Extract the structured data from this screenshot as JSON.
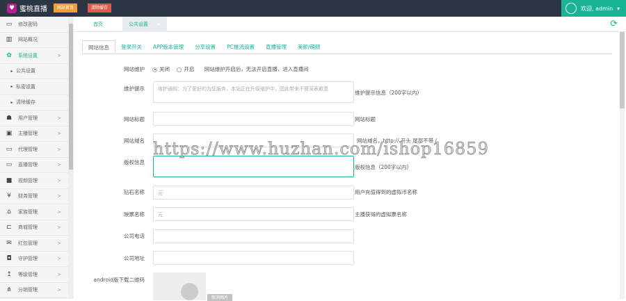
{
  "header": {
    "app_name": "蜜桃直播",
    "home_btn": "网站首页",
    "clear_cache_btn": "清除缓存",
    "user_greeting": "欢迎, admin",
    "colors": {
      "header": "#2b3544",
      "accent": "#1ab394",
      "home_btn": "#f0a030",
      "clear_btn": "#e4574e"
    }
  },
  "sidebar": {
    "items": [
      {
        "label": "修改密码",
        "icon": "monitor-icon"
      },
      {
        "label": "网站概况",
        "icon": "bar-chart-icon"
      },
      {
        "label": "系统设置",
        "icon": "gears-icon"
      },
      {
        "label": "公共设置",
        "icon": "caret-icon"
      },
      {
        "label": "私密设置",
        "icon": "caret-icon"
      },
      {
        "label": "清除缓存",
        "icon": "caret-icon"
      },
      {
        "label": "用户管理",
        "icon": "users-icon"
      },
      {
        "label": "主播管理",
        "icon": "id-badge-icon"
      },
      {
        "label": "代理管理",
        "icon": "monitor-icon"
      },
      {
        "label": "直播管理",
        "icon": "monitor-icon"
      },
      {
        "label": "视频管理",
        "icon": "video-icon"
      },
      {
        "label": "财务管理",
        "icon": "yen-icon"
      },
      {
        "label": "家族管理",
        "icon": "bank-icon"
      },
      {
        "label": "商城管理",
        "icon": "cart-icon"
      },
      {
        "label": "红包管理",
        "icon": "envelope-icon"
      },
      {
        "label": "守护管理",
        "icon": "shield-icon"
      },
      {
        "label": "等级管理",
        "icon": "level-up-icon"
      },
      {
        "label": "分销管理",
        "icon": "sitemap-icon"
      }
    ]
  },
  "tabs": [
    {
      "label": "首页"
    },
    {
      "label": "公共设置"
    }
  ],
  "subtabs": [
    "网站信息",
    "登录开关",
    "APP版本管理",
    "分享设置",
    "PC推流设置",
    "直播管理",
    "美颜/萌颜"
  ],
  "form": {
    "maintenance": {
      "label": "网站维护",
      "off": "关闭",
      "on": "开启",
      "selected": "关闭",
      "hint": "网站维护开启后，无法开启直播，进入直播间"
    },
    "maint_tip": {
      "label": "维护提示",
      "placeholder": "维护通知：为了更好的为您服务，本站正在升级维护中，因此带来不便深表歉意",
      "hint": "维护提示信息（200字以内）"
    },
    "site_title": {
      "label": "网站标题",
      "value": "",
      "hint": "网站标题"
    },
    "site_domain": {
      "label": "网站域名",
      "value": "",
      "hint": "网站域名，http:// 开头 尾部不带 /"
    },
    "copyright": {
      "label": "版权信息",
      "value": "",
      "hint": "版权信息（200字以内）"
    },
    "diamond_name": {
      "label": "钻石名称",
      "value": "元",
      "hint": "用户充值得到的虚拟币名称"
    },
    "ticket_name": {
      "label": "映票名称",
      "value": "元",
      "hint": "主播获得的虚拟票名称"
    },
    "company_phone": {
      "label": "公司电话",
      "value": ""
    },
    "company_addr": {
      "label": "公司地址",
      "value": ""
    },
    "android_qr": {
      "label": "android版下载二维码",
      "button": "取消图片"
    }
  },
  "watermark": "https://www.huzhan.com/ishop16859"
}
